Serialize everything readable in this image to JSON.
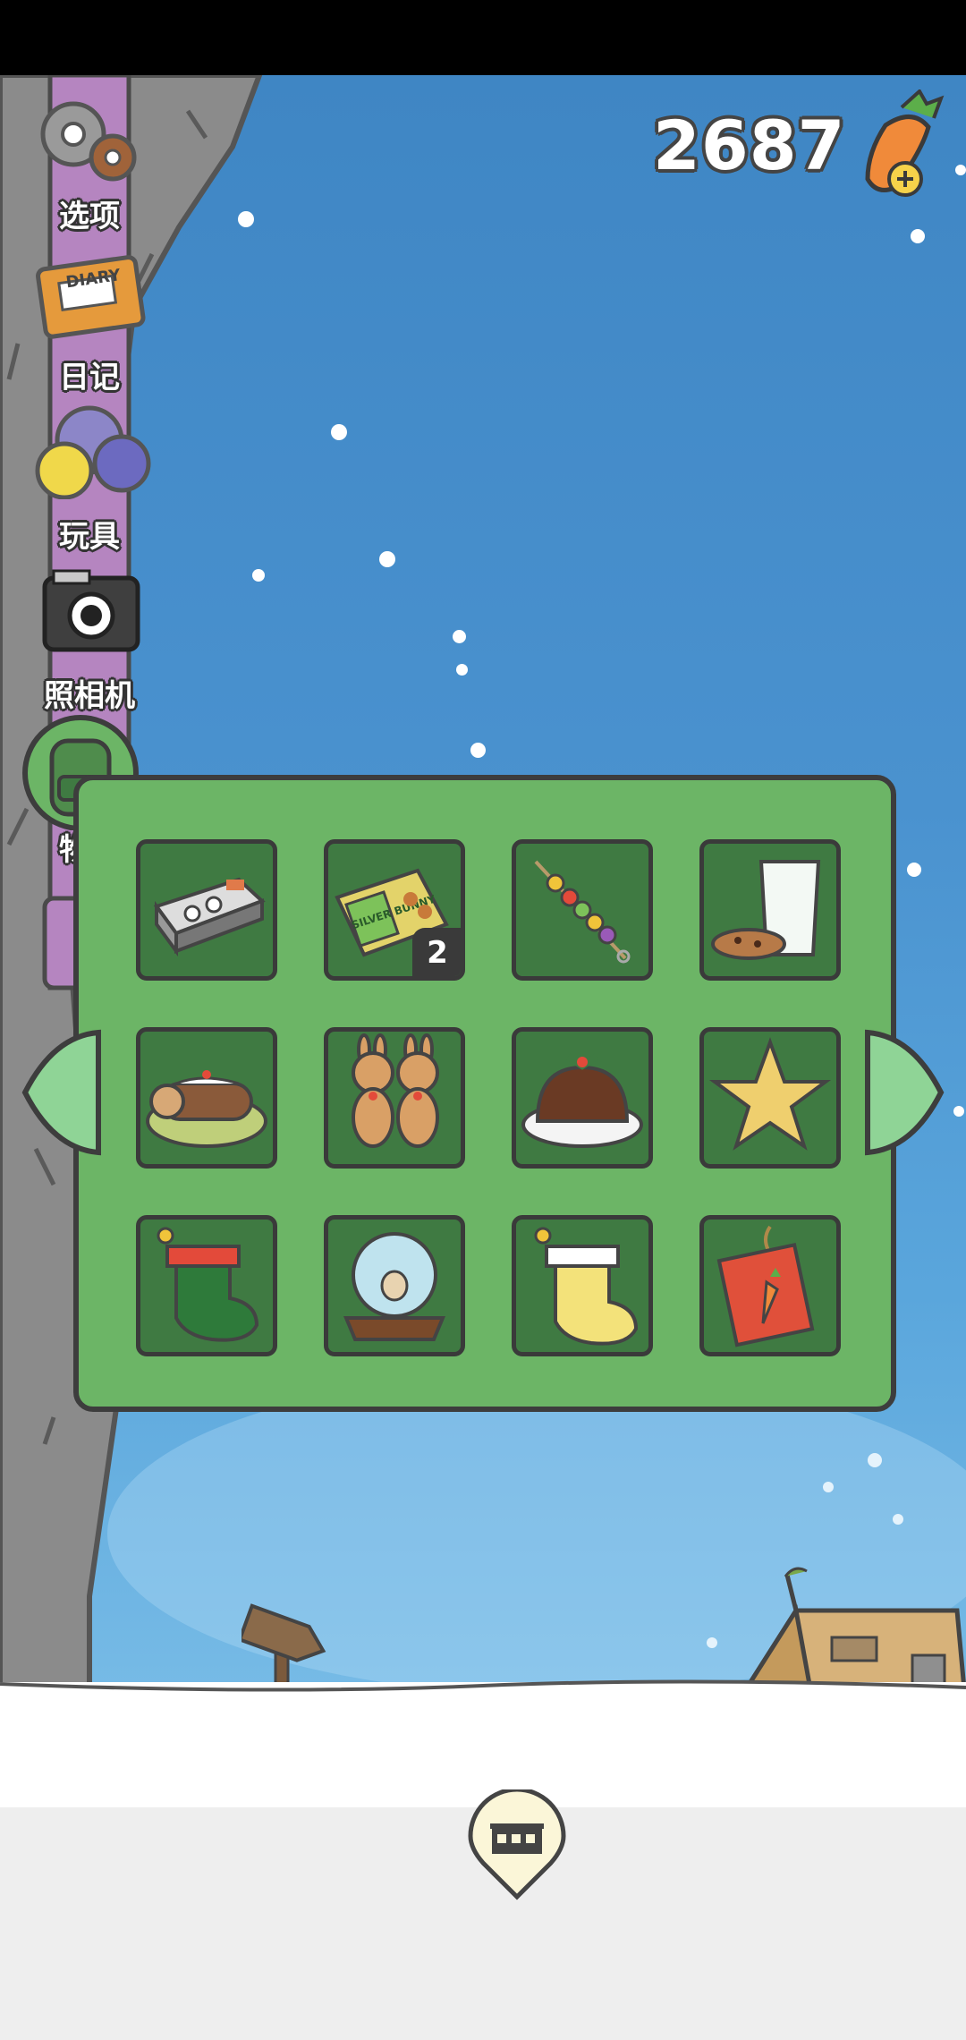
{
  "header": {
    "carrot_count": "2687",
    "add_icon": "carrot-plus-icon"
  },
  "side_menu": [
    {
      "id": "options",
      "label": "选项",
      "icon": "gear-icon"
    },
    {
      "id": "diary",
      "label": "日记",
      "icon": "diary-icon",
      "icon_text": "DIARY"
    },
    {
      "id": "toys",
      "label": "玩具",
      "icon": "balls-icon"
    },
    {
      "id": "camera",
      "label": "照相机",
      "icon": "camera-icon"
    },
    {
      "id": "items",
      "label": "物品",
      "icon": "backpack-icon",
      "active": true
    }
  ],
  "inventory": {
    "items": [
      {
        "name": "sushi-box",
        "count": null
      },
      {
        "name": "silver-bunny-candy-box",
        "count": "2",
        "label": "SILVER BUNNY"
      },
      {
        "name": "veggie-skewer",
        "count": null
      },
      {
        "name": "milk-and-cookies",
        "count": null
      },
      {
        "name": "yule-log-cake",
        "count": null
      },
      {
        "name": "gingerbread-bunnies",
        "count": null
      },
      {
        "name": "christmas-pudding",
        "count": null
      },
      {
        "name": "gold-star-topper",
        "count": null
      },
      {
        "name": "green-red-stocking",
        "count": null
      },
      {
        "name": "bunny-snow-globe",
        "count": null
      },
      {
        "name": "yellow-stocking",
        "count": null
      },
      {
        "name": "carrot-red-envelope",
        "count": null
      }
    ],
    "prev_icon": "arrow-left-icon",
    "next_icon": "arrow-right-icon"
  },
  "bottom": {
    "home_icon": "house-pin-icon"
  },
  "colors": {
    "panel": "#6cb566",
    "slot": "#3f7a42",
    "sky": "#4a92cf",
    "menu_strip": "#b585c0"
  }
}
